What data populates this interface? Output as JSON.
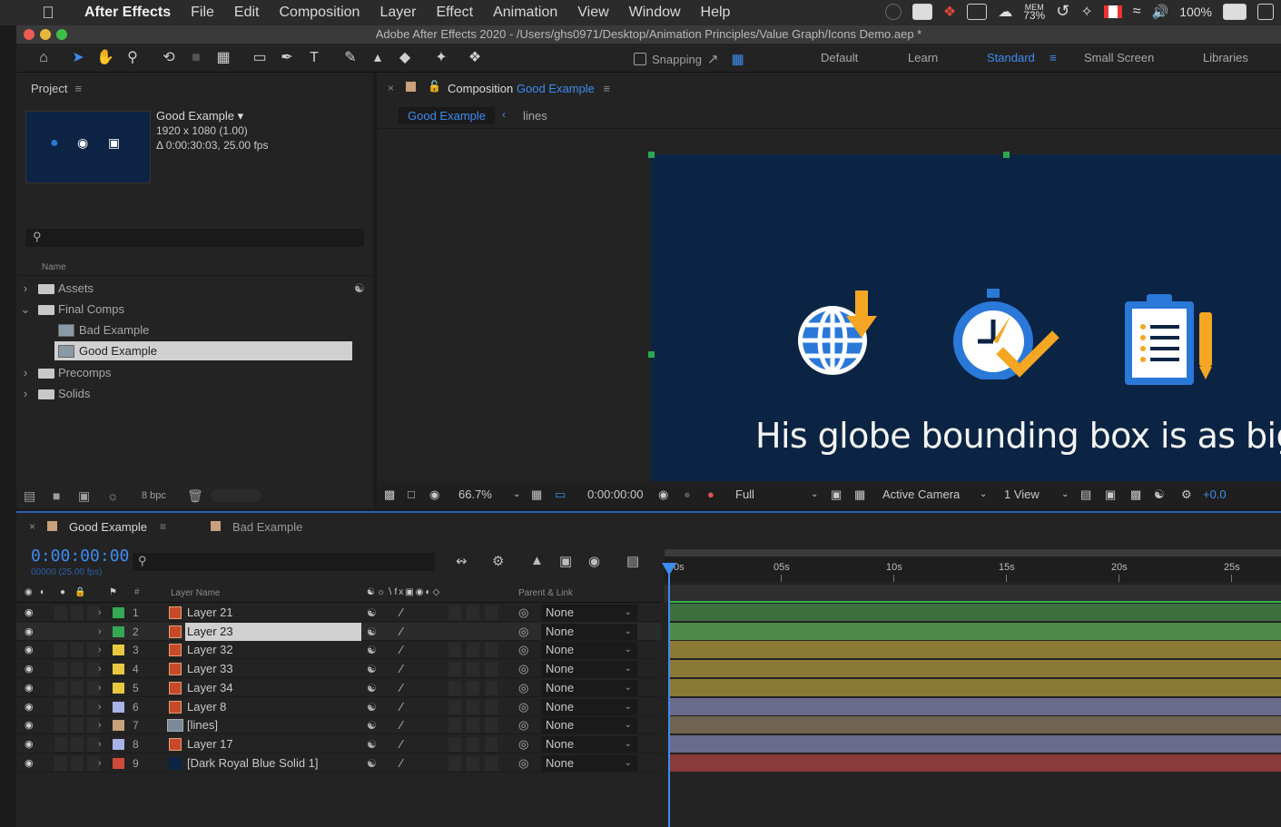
{
  "menubar": {
    "app_name": "After Effects",
    "items": [
      "File",
      "Edit",
      "Composition",
      "Layer",
      "Effect",
      "Animation",
      "View",
      "Window",
      "Help"
    ],
    "mem_label": "MEM",
    "mem_value": "73%",
    "battery_pct": "100%"
  },
  "window": {
    "title": "Adobe After Effects 2020 - /Users/ghs0971/Desktop/Animation Principles/Value Graph/Icons Demo.aep *"
  },
  "toolbar": {
    "snapping_label": "Snapping",
    "workspaces": [
      "Default",
      "Learn",
      "Standard",
      "Small Screen",
      "Libraries"
    ],
    "active_workspace": "Standard"
  },
  "project": {
    "tab_label": "Project",
    "selected_name": "Good Example",
    "selected_res": "1920 x 1080 (1.00)",
    "selected_dur": "Δ 0:00:30:03, 25.00 fps",
    "column_name": "Name",
    "tree": [
      {
        "label": "Assets",
        "type": "folder",
        "expanded": false
      },
      {
        "label": "Final Comps",
        "type": "folder",
        "expanded": true
      },
      {
        "label": "Bad Example",
        "type": "comp"
      },
      {
        "label": "Good Example",
        "type": "comp",
        "selected": true
      },
      {
        "label": "Precomps",
        "type": "folder",
        "expanded": false
      },
      {
        "label": "Solids",
        "type": "folder",
        "expanded": false
      }
    ],
    "bpc": "8 bpc"
  },
  "composition": {
    "tab_prefix": "Composition",
    "tab_name": "Good Example",
    "breadcrumb_active": "Good Example",
    "breadcrumb_next": "lines",
    "caption": "His globe bounding box is as big as comp window",
    "zoom": "66.7%",
    "timecode": "0:00:00:00",
    "resolution": "Full",
    "camera": "Active Camera",
    "views": "1 View",
    "exposure": "+0.0"
  },
  "timeline": {
    "tabs": [
      "Good Example",
      "Bad Example"
    ],
    "active_tab": "Good Example",
    "timecode": "0:00:00:00",
    "frames": "00000 (25.00 fps)",
    "header_layer_name": "Layer Name",
    "header_parent": "Parent & Link",
    "ruler": [
      "0s",
      "05s",
      "10s",
      "15s",
      "20s",
      "25s"
    ],
    "layers": [
      {
        "num": "1",
        "name": "Layer 21",
        "label_color": "#34a853",
        "parent": "None",
        "bar": "#3e6e3e",
        "type": "shape"
      },
      {
        "num": "2",
        "name": "Layer 23",
        "label_color": "#34a853",
        "parent": "None",
        "bar": "#4e8a4a",
        "type": "shape",
        "selected": true
      },
      {
        "num": "3",
        "name": "Layer 32",
        "label_color": "#e8c840",
        "parent": "None",
        "bar": "#8a7a35",
        "type": "shape"
      },
      {
        "num": "4",
        "name": "Layer 33",
        "label_color": "#e8c840",
        "parent": "None",
        "bar": "#8a7a35",
        "type": "shape"
      },
      {
        "num": "5",
        "name": "Layer 34",
        "label_color": "#e8c840",
        "parent": "None",
        "bar": "#8a7a35",
        "type": "shape"
      },
      {
        "num": "6",
        "name": "Layer 8",
        "label_color": "#a8b4e8",
        "parent": "None",
        "bar": "#6a6a8a",
        "type": "shape"
      },
      {
        "num": "7",
        "name": "[lines]",
        "label_color": "#c8a07a",
        "parent": "None",
        "bar": "#706450",
        "type": "precomp"
      },
      {
        "num": "8",
        "name": "Layer 17",
        "label_color": "#a8b4e8",
        "parent": "None",
        "bar": "#6a6a8a",
        "type": "shape"
      },
      {
        "num": "9",
        "name": "[Dark Royal Blue Solid 1]",
        "label_color": "#d04a3a",
        "parent": "None",
        "bar": "#8a3a38",
        "type": "solid"
      }
    ]
  },
  "colors": {
    "accent": "#3d8cf0",
    "comp_bg": "#0b2444"
  },
  "icons": [
    "apple-icon",
    "home-icon",
    "selection-icon",
    "hand-icon",
    "zoom-icon",
    "globe-icon",
    "stopwatch-icon",
    "clipboard-icon"
  ]
}
